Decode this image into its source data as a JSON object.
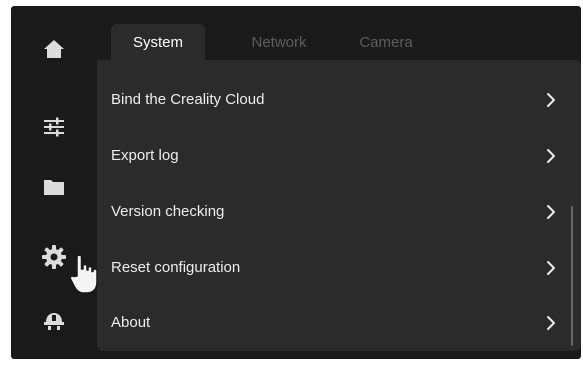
{
  "sidebar": {
    "items": [
      {
        "id": "home",
        "icon": "home-icon"
      },
      {
        "id": "tune",
        "icon": "sliders-icon"
      },
      {
        "id": "files",
        "icon": "folder-icon"
      },
      {
        "id": "settings",
        "icon": "gear-icon",
        "active": true
      },
      {
        "id": "service",
        "icon": "helmet-icon"
      }
    ]
  },
  "tabs": [
    {
      "label": "System",
      "active": true
    },
    {
      "label": "Network",
      "active": false
    },
    {
      "label": "Camera",
      "active": false
    }
  ],
  "menu": {
    "items": [
      {
        "label": "Bind the Creality Cloud"
      },
      {
        "label": "Export log"
      },
      {
        "label": "Version checking"
      },
      {
        "label": "Reset configuration"
      },
      {
        "label": "About"
      }
    ]
  },
  "cursor": {
    "icon": "pointing-hand-icon"
  },
  "colors": {
    "background": "#1a1a1a",
    "panel": "#2b2b2b",
    "text": "#ededed",
    "inactive_tab": "#5d5d5d",
    "icon": "#dcdcdc"
  }
}
